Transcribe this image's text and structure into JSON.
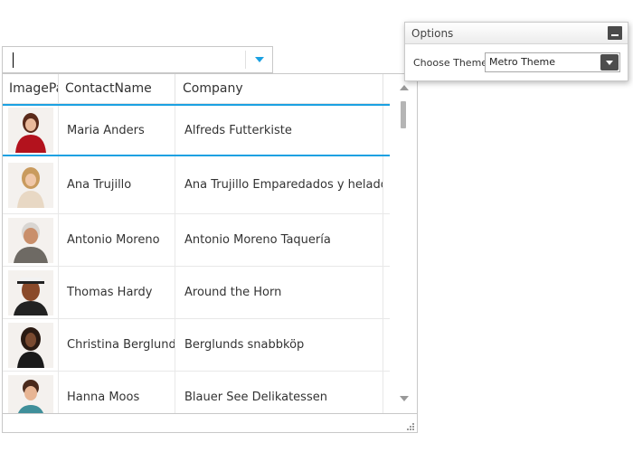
{
  "combo": {
    "value": "",
    "arrow_icon": "triangle-down-icon",
    "accent_color": "#1ba1e2"
  },
  "grid": {
    "columns": [
      "ImagePath",
      "ContactName",
      "Company"
    ],
    "selected_index": 0,
    "selection_color": "#1ba1e2",
    "rows": [
      {
        "photo_icon": "person-photo-icon",
        "contact_name": "Maria Anders",
        "company": "Alfreds Futterkiste"
      },
      {
        "photo_icon": "person-photo-icon",
        "contact_name": "Ana Trujillo",
        "company": "Ana Trujillo Emparedados y helados"
      },
      {
        "photo_icon": "person-photo-icon",
        "contact_name": "Antonio Moreno",
        "company": "Antonio Moreno Taquería"
      },
      {
        "photo_icon": "person-photo-icon",
        "contact_name": "Thomas Hardy",
        "company": "Around the Horn"
      },
      {
        "photo_icon": "person-photo-icon",
        "contact_name": "Christina Berglund",
        "company": "Berglunds snabbköp"
      },
      {
        "photo_icon": "person-photo-icon",
        "contact_name": "Hanna Moos",
        "company": "Blauer See Delikatessen"
      }
    ]
  },
  "options": {
    "title": "Options",
    "minimize_icon": "minimize-icon",
    "theme_label": "Choose Theme:",
    "theme_value": "Metro Theme",
    "dropdown_icon": "chevron-down-icon"
  }
}
